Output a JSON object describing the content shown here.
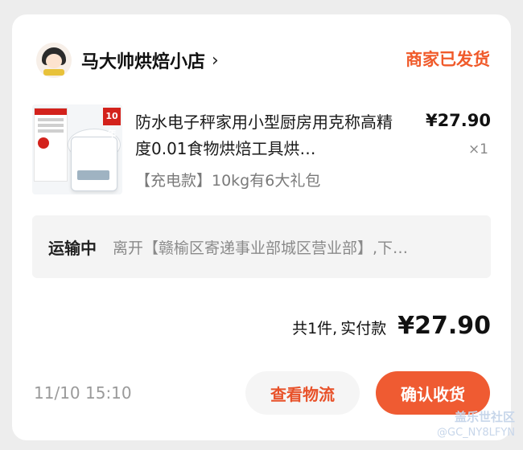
{
  "shop": {
    "name": "马大帅烘焙小店",
    "chevron": "›",
    "avatar_icon": "shop-avatar-cartoon"
  },
  "order": {
    "status": "商家已发货",
    "status_color": "#f05a2a",
    "time": "11/10 15:10"
  },
  "product": {
    "title": "防水电子秤家用小型厨房用克称高精度0.01食物烘焙工具烘…",
    "variant": "【充电款】10kg有6大礼包",
    "price": "¥27.90",
    "quantity": "×1",
    "image_badge": "10年"
  },
  "logistics": {
    "status": "运输中",
    "detail": "离开【赣榆区寄递事业部城区营业部】,下…"
  },
  "summary": {
    "count": "共1件,",
    "label": "实付款",
    "amount": "¥27.90"
  },
  "buttons": {
    "view_logistics": "查看物流",
    "confirm_receipt": "确认收货",
    "accent_color": "#ef5b32"
  },
  "watermark": {
    "title": "盖乐世社区",
    "user": "@GC_NY8LFYN"
  }
}
